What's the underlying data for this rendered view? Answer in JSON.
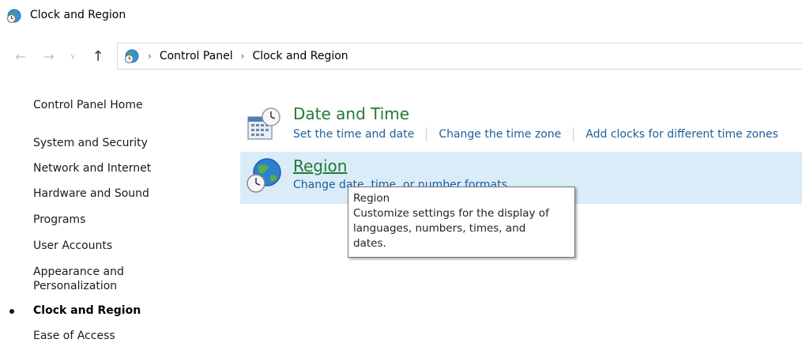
{
  "window": {
    "title": "Clock and Region",
    "icon": "clock-globe-icon"
  },
  "navigation": {
    "back_icon": "back-arrow-icon",
    "forward_icon": "forward-arrow-icon",
    "recent_icon": "chevron-down-icon",
    "up_icon": "up-arrow-icon",
    "breadcrumb": [
      "Control Panel",
      "Clock and Region"
    ],
    "separator": "›"
  },
  "sidebar": {
    "items": [
      {
        "label": "Control Panel Home"
      },
      {
        "label": "System and Security"
      },
      {
        "label": "Network and Internet"
      },
      {
        "label": "Hardware and Sound"
      },
      {
        "label": "Programs"
      },
      {
        "label": "User Accounts"
      },
      {
        "label": "Appearance and Personalization",
        "lines": [
          "Appearance and",
          "Personalization"
        ]
      },
      {
        "label": "Clock and Region",
        "current": true
      },
      {
        "label": "Ease of Access"
      }
    ]
  },
  "categories": [
    {
      "title": "Date and Time",
      "icon": "calendar-clock-icon",
      "links": [
        "Set the time and date",
        "Change the time zone",
        "Add clocks for different time zones"
      ]
    },
    {
      "title": "Region",
      "icon": "globe-clock-icon",
      "links": [
        "Change date, time, or number formats"
      ],
      "hovered": true
    }
  ],
  "tooltip": {
    "lines": [
      "Region",
      "Customize settings for the display of",
      "languages, numbers, times, and",
      "dates."
    ]
  },
  "colors": {
    "category_title": "#227a33",
    "link": "#1c5e9c",
    "hover_bg": "#dbecf9"
  }
}
